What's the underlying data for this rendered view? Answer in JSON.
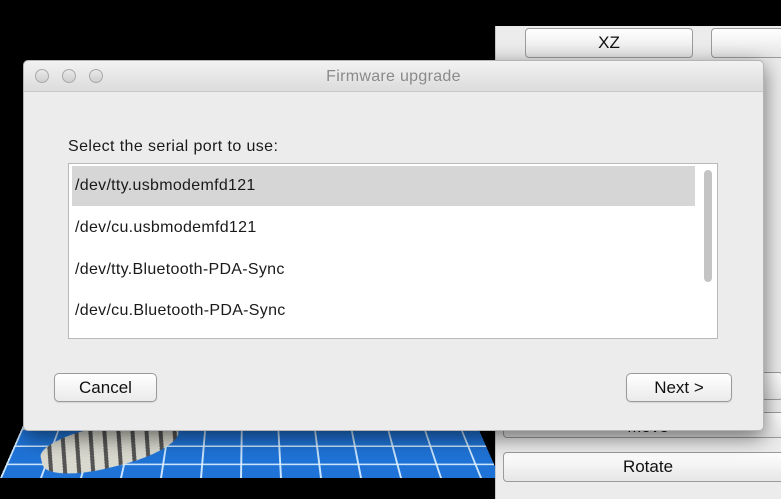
{
  "background_app": {
    "buttons": {
      "xz": "XZ",
      "move": "Move",
      "rotate": "Rotate"
    },
    "colors": {
      "grid": "#1f73d6",
      "panel": "#ececec"
    }
  },
  "dialog": {
    "title": "Firmware upgrade",
    "window_controls": [
      "close-icon",
      "minimize-icon",
      "zoom-icon"
    ],
    "prompt": "Select the serial port to use:",
    "ports": [
      {
        "label": "/dev/tty.usbmodemfd121",
        "selected": true
      },
      {
        "label": "/dev/cu.usbmodemfd121",
        "selected": false
      },
      {
        "label": "/dev/tty.Bluetooth-PDA-Sync",
        "selected": false
      },
      {
        "label": "/dev/cu.Bluetooth-PDA-Sync",
        "selected": false
      }
    ],
    "cancel_label": "Cancel",
    "next_label": "Next >"
  }
}
